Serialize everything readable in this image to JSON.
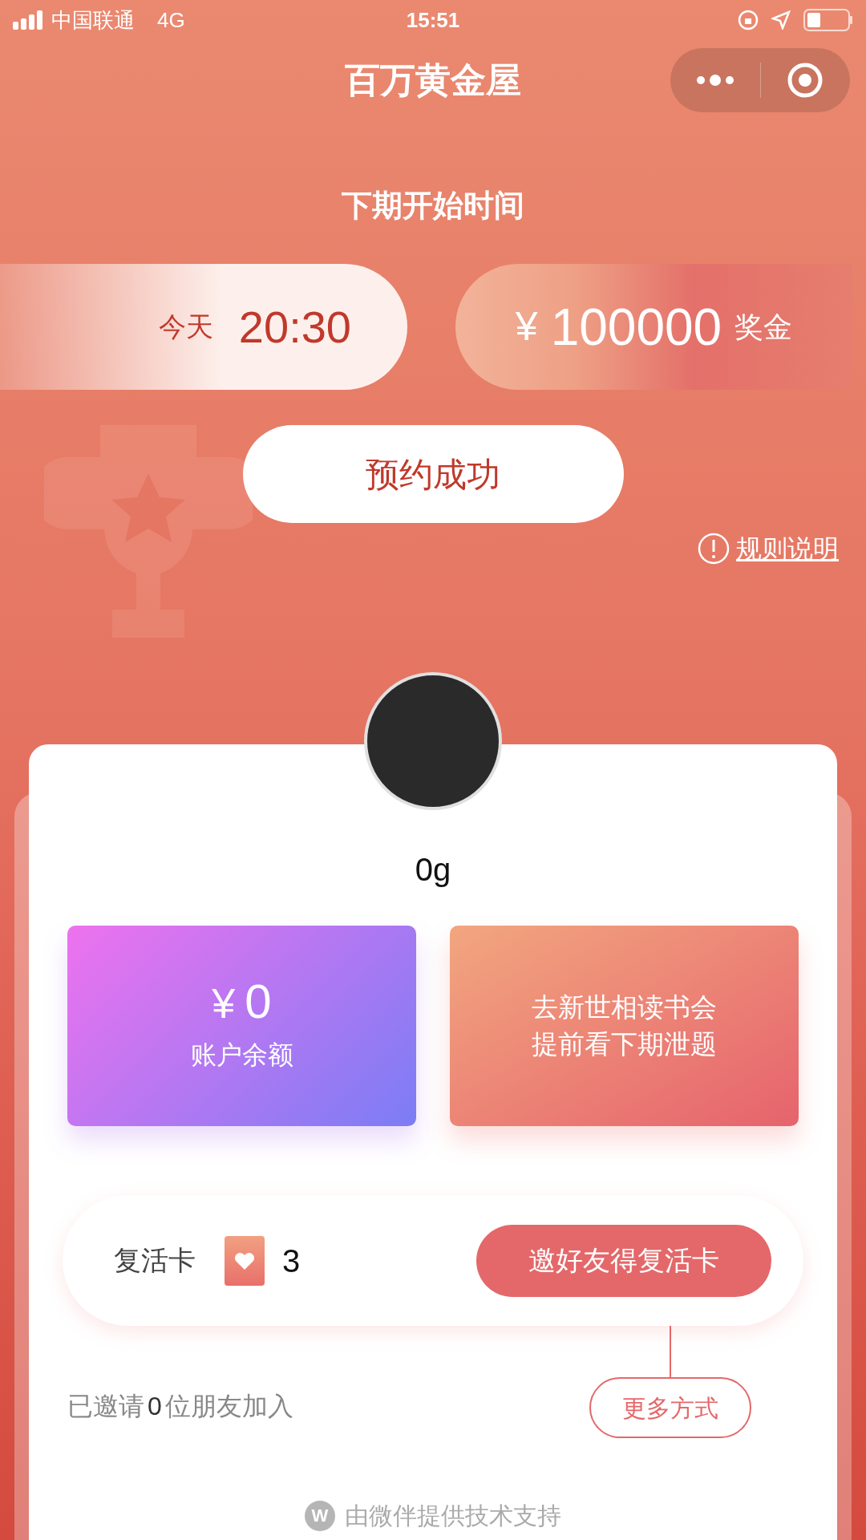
{
  "status_bar": {
    "carrier": "中国联通",
    "network": "4G",
    "time": "15:51"
  },
  "nav": {
    "title": "百万黄金屋"
  },
  "next_round": {
    "heading": "下期开始时间",
    "day": "今天",
    "time": "20:30",
    "currency": "¥",
    "prize": "100000",
    "prize_label": "奖金"
  },
  "reserve_button": "预约成功",
  "rules_link": "规则说明",
  "user": {
    "weight": "0g"
  },
  "tiles": [
    {
      "kind": "balance",
      "currency": "¥",
      "amount": "0",
      "label": "账户余额"
    },
    {
      "kind": "promo",
      "lines": [
        "去新世相读书会",
        "提前看下期泄题"
      ]
    }
  ],
  "revive": {
    "label": "复活卡",
    "count": "3",
    "button": "邀好友得复活卡"
  },
  "invite": {
    "prefix": "已邀请",
    "count": "0",
    "suffix": "位朋友加入",
    "more_button": "更多方式"
  },
  "footer": {
    "logo": "W",
    "text": "由微伴提供技术支持"
  }
}
